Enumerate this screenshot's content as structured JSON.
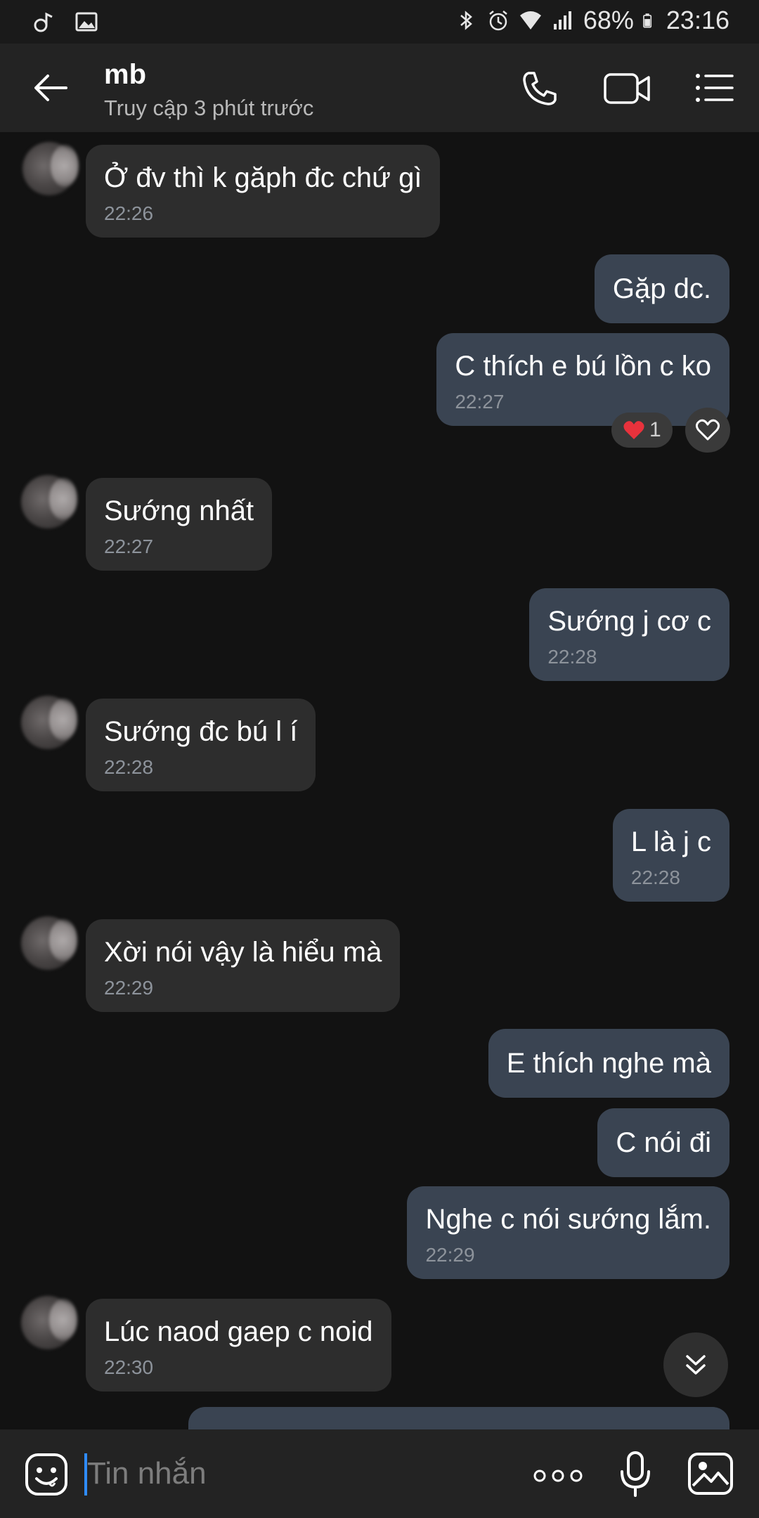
{
  "status_bar": {
    "battery": "68%",
    "time": "23:16",
    "left_icons": [
      "bluetooth-music-icon",
      "image-icon"
    ],
    "right_icons": [
      "bluetooth-icon",
      "alarm-icon",
      "wifi-icon",
      "signal-icon",
      "battery-icon"
    ]
  },
  "header": {
    "name": "mb",
    "status": "Truy cập 3 phút trước",
    "icons": [
      "back-arrow-icon",
      "phone-icon",
      "video-icon",
      "menu-icon"
    ]
  },
  "messages": [
    {
      "dir": "in",
      "text": "Ở đv thì k găph đc chứ gì",
      "time": "22:26"
    },
    {
      "dir": "out",
      "text": "Gặp dc.",
      "time": ""
    },
    {
      "dir": "out",
      "text": "C thích e bú lồn c ko",
      "time": "22:27",
      "reaction_count": "1"
    },
    {
      "dir": "in",
      "text": "Sướng nhất",
      "time": "22:27"
    },
    {
      "dir": "out",
      "text": "Sướng j cơ c",
      "time": "22:28"
    },
    {
      "dir": "in",
      "text": "Sướng đc bú l í",
      "time": "22:28"
    },
    {
      "dir": "out",
      "text": "L là j c",
      "time": "22:28"
    },
    {
      "dir": "in",
      "text": "Xời nói vậy là hiểu mà",
      "time": "22:29"
    },
    {
      "dir": "out",
      "text": "E thích nghe mà",
      "time": ""
    },
    {
      "dir": "out",
      "text": "C nói đi",
      "time": ""
    },
    {
      "dir": "out",
      "text": "Nghe c nói sướng lắm.",
      "time": "22:29"
    },
    {
      "dir": "in",
      "text": "Lúc naod gaep c noid",
      "time": "22:30"
    }
  ],
  "input": {
    "placeholder": "Tin nhắn",
    "icons": [
      "sticker-icon",
      "more-icon",
      "microphone-icon",
      "gallery-icon"
    ]
  },
  "colors": {
    "background": "#121212",
    "incoming_bubble": "#2d2d2d",
    "outgoing_bubble": "#3a4452",
    "cursor": "#2f8cff"
  }
}
